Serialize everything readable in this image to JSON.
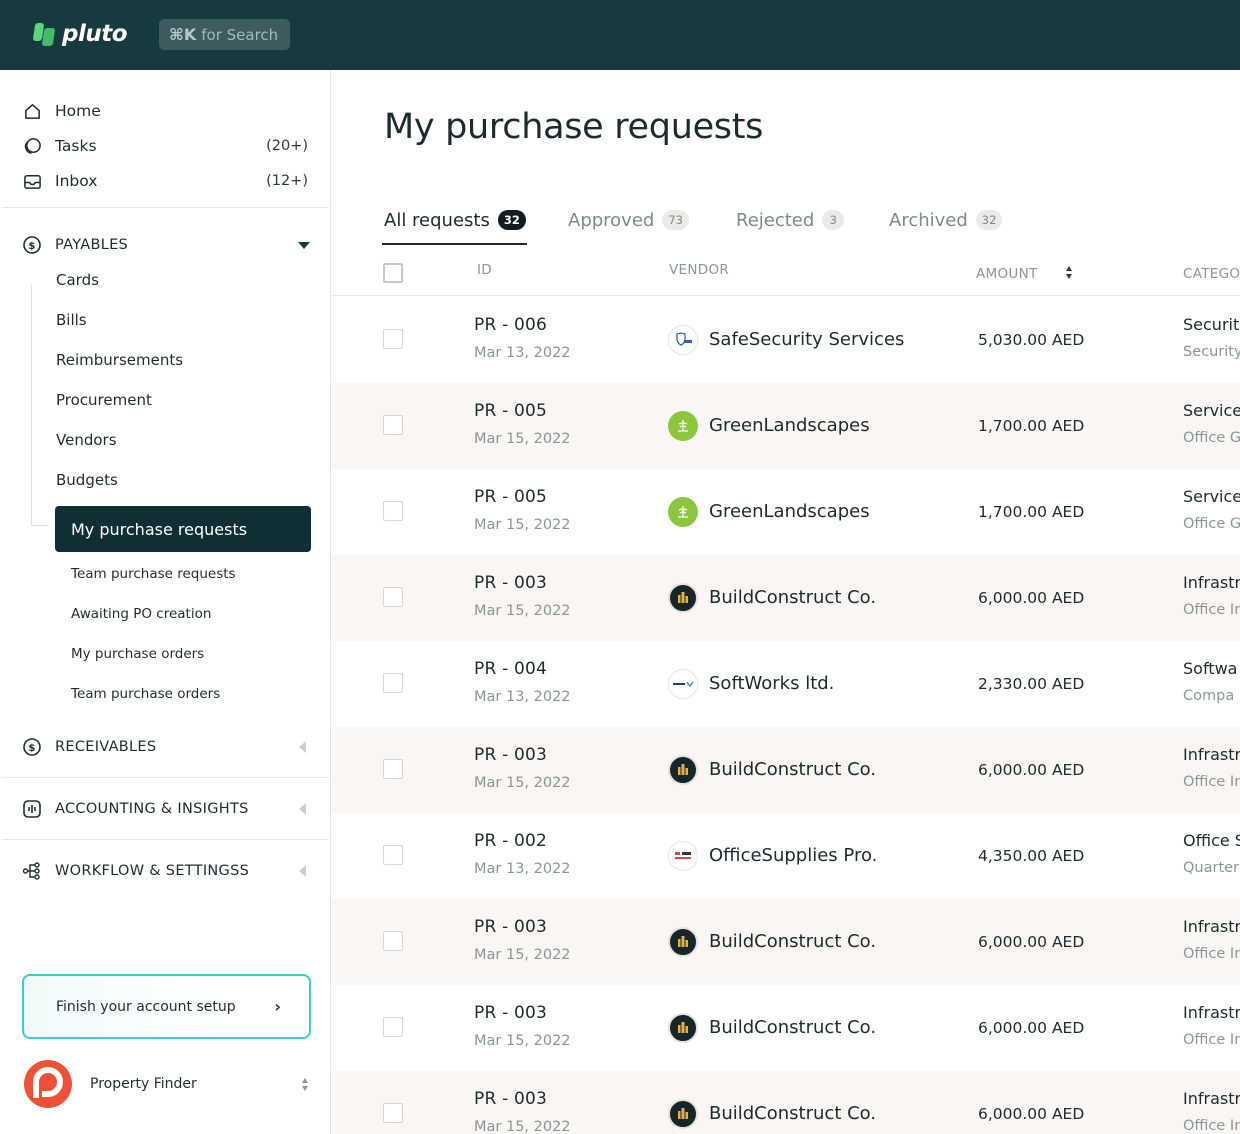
{
  "app": {
    "brand": "pluto",
    "search_hint_key": "⌘K",
    "search_hint_text": "for Search"
  },
  "sidebar": {
    "top_items": [
      {
        "label": "Home",
        "count": "",
        "icon": "home-icon"
      },
      {
        "label": "Tasks",
        "count": "(20+)",
        "icon": "tasks-icon"
      },
      {
        "label": "Inbox",
        "count": "(12+)",
        "icon": "inbox-icon"
      }
    ],
    "payables": {
      "label": "PAYABLES",
      "items": [
        "Cards",
        "Bills",
        "Reimbursements",
        "Procurement",
        "Vendors",
        "Budgets"
      ],
      "active_item": "My purchase requests",
      "sub_items": [
        "Team purchase requests",
        "Awaiting PO creation",
        "My purchase  orders",
        "Team purchase  orders"
      ]
    },
    "receivables": {
      "label": "RECEIVABLES"
    },
    "accounting": {
      "label": "ACCOUNTING & INSIGHTS"
    },
    "workflow": {
      "label": "WORKFLOW & SETTINGSS"
    },
    "setup_card": {
      "label": "Finish your account setup",
      "chevron": "›"
    },
    "company": {
      "name": "Property Finder"
    }
  },
  "main": {
    "title": "My purchase requests",
    "tabs": [
      {
        "label": "All requests",
        "count": "32",
        "active": true
      },
      {
        "label": "Approved",
        "count": "73",
        "active": false
      },
      {
        "label": "Rejected",
        "count": "3",
        "active": false
      },
      {
        "label": "Archived",
        "count": "32",
        "active": false
      }
    ],
    "columns": {
      "id": "ID",
      "vendor": "VENDOR",
      "amount": "AMOUNT",
      "category": "CATEGO"
    },
    "rows": [
      {
        "id": "PR - 006",
        "date": "Mar 13, 2022",
        "vendor": "SafeSecurity Services",
        "vendor_logo": "safesecurity-logo",
        "amount": "5,030.00 AED",
        "category": "Securit",
        "subcategory": "Security"
      },
      {
        "id": "PR - 005",
        "date": "Mar 15, 2022",
        "vendor": "GreenLandscapes",
        "vendor_logo": "greenlandscapes-logo",
        "amount": "1,700.00 AED",
        "category": "Service",
        "subcategory": "Office G"
      },
      {
        "id": "PR - 005",
        "date": "Mar 15, 2022",
        "vendor": "GreenLandscapes",
        "vendor_logo": "greenlandscapes-logo",
        "amount": "1,700.00 AED",
        "category": "Service",
        "subcategory": "Office G"
      },
      {
        "id": "PR - 003",
        "date": "Mar 15, 2022",
        "vendor": "BuildConstruct Co.",
        "vendor_logo": "buildconstruct-logo",
        "amount": "6,000.00 AED",
        "category": "Infrastr",
        "subcategory": "Office Ir"
      },
      {
        "id": "PR - 004",
        "date": "Mar 13, 2022",
        "vendor": "SoftWorks ltd.",
        "vendor_logo": "softworks-logo",
        "amount": "2,330.00 AED",
        "category": "Softwa",
        "subcategory": "Compa"
      },
      {
        "id": "PR - 003",
        "date": "Mar 15, 2022",
        "vendor": "BuildConstruct Co.",
        "vendor_logo": "buildconstruct-logo",
        "amount": "6,000.00 AED",
        "category": "Infrastr",
        "subcategory": "Office Ir"
      },
      {
        "id": "PR - 002",
        "date": "Mar 13, 2022",
        "vendor": "OfficeSupplies Pro.",
        "vendor_logo": "officesupplies-logo",
        "amount": "4,350.00 AED",
        "category": "Office S",
        "subcategory": "Quarter"
      },
      {
        "id": "PR - 003",
        "date": "Mar 15, 2022",
        "vendor": "BuildConstruct Co.",
        "vendor_logo": "buildconstruct-logo",
        "amount": "6,000.00 AED",
        "category": "Infrastr",
        "subcategory": "Office Ir"
      },
      {
        "id": "PR - 003",
        "date": "Mar 15, 2022",
        "vendor": "BuildConstruct Co.",
        "vendor_logo": "buildconstruct-logo",
        "amount": "6,000.00 AED",
        "category": "Infrastr",
        "subcategory": "Office Ir"
      },
      {
        "id": "PR - 003",
        "date": "Mar 15, 2022",
        "vendor": "BuildConstruct Co.",
        "vendor_logo": "buildconstruct-logo",
        "amount": "6,000.00 AED",
        "category": "Infrastr",
        "subcategory": "Office Ir"
      }
    ]
  },
  "colors": {
    "topbar": "#173a40",
    "accent": "#0f2f35",
    "brand_green": "#5fd47e",
    "setup_border": "#3cd0c4",
    "row_alt": "#faf6f4"
  }
}
